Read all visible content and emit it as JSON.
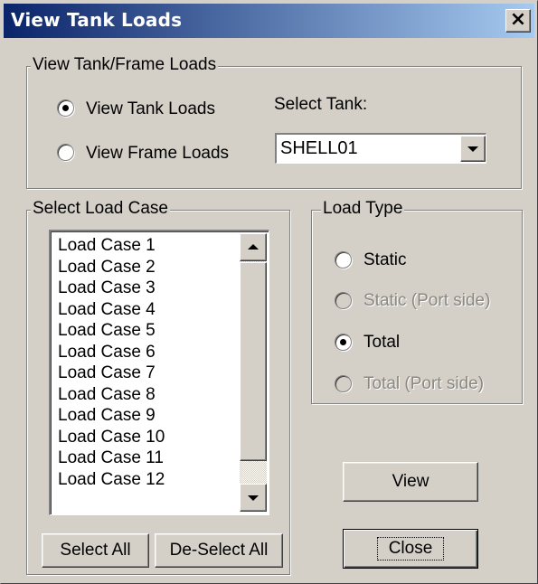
{
  "window": {
    "title": "View Tank Loads",
    "close_glyph": "×"
  },
  "tank_frame_group": {
    "legend": "View Tank/Frame Loads",
    "options": [
      {
        "label": "View Tank Loads",
        "selected": true
      },
      {
        "label": "View Frame Loads",
        "selected": false
      }
    ],
    "select_tank_label": "Select Tank:",
    "select_tank_value": "SHELL01"
  },
  "load_case_group": {
    "legend": "Select Load Case",
    "items": [
      "Load Case 1",
      "Load Case 2",
      "Load Case 3",
      "Load Case 4",
      "Load Case 5",
      "Load Case 6",
      "Load Case 7",
      "Load Case 8",
      "Load Case 9",
      "Load Case 10",
      "Load Case 11",
      "Load Case 12"
    ],
    "select_all_label": "Select All",
    "deselect_all_label": "De-Select All"
  },
  "load_type_group": {
    "legend": "Load Type",
    "options": [
      {
        "label": "Static",
        "selected": false,
        "enabled": true
      },
      {
        "label": "Static (Port side)",
        "selected": false,
        "enabled": false
      },
      {
        "label": "Total",
        "selected": true,
        "enabled": true
      },
      {
        "label": "Total (Port side)",
        "selected": false,
        "enabled": false
      }
    ]
  },
  "actions": {
    "view_label": "View",
    "close_label": "Close"
  },
  "icons": {
    "radio_selected": "radio-selected-icon",
    "radio_unselected": "radio-unselected-icon",
    "dropdown": "chevron-down-icon",
    "scroll_up": "chevron-up-icon",
    "scroll_down": "chevron-down-icon"
  },
  "colors": {
    "face": "#d4d0c8",
    "title_start": "#0a246a",
    "title_end": "#a6caf0",
    "disabled_text": "#8a8880"
  }
}
